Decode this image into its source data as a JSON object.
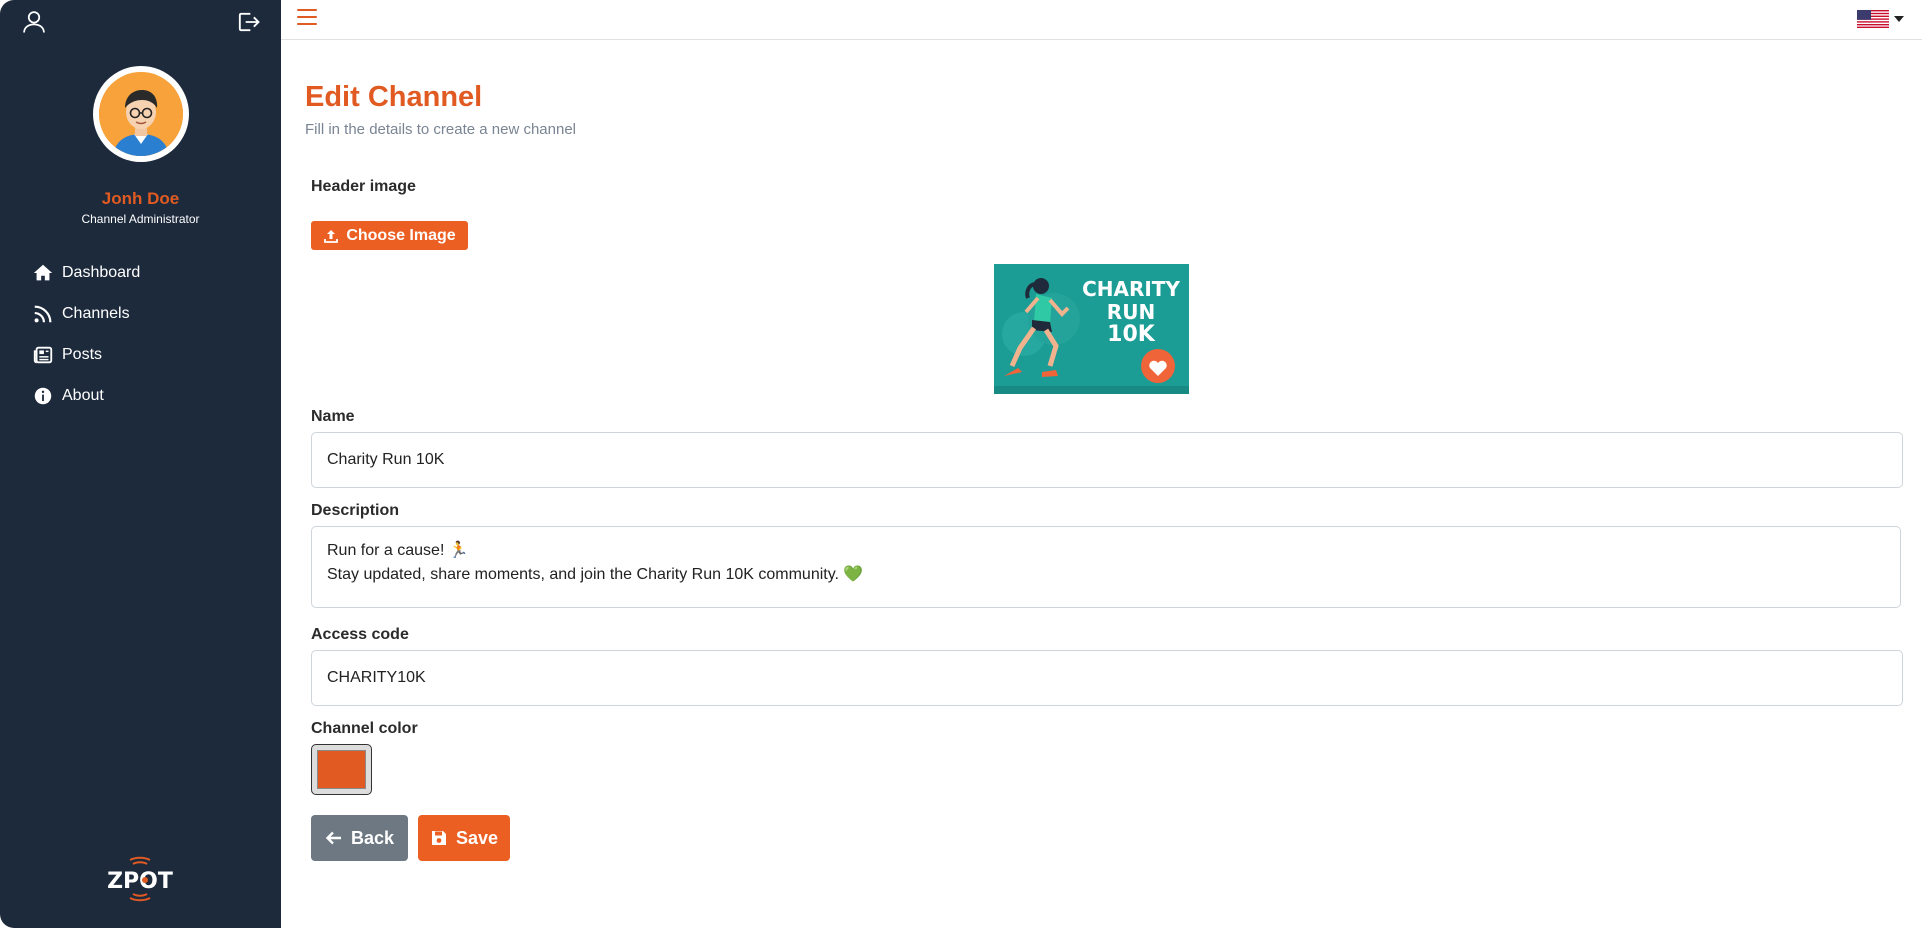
{
  "sidebar": {
    "user": {
      "name": "Jonh Doe",
      "role": "Channel Administrator"
    },
    "items": [
      {
        "label": "Dashboard",
        "icon": "home-icon"
      },
      {
        "label": "Channels",
        "icon": "rss-icon"
      },
      {
        "label": "Posts",
        "icon": "newspaper-icon"
      },
      {
        "label": "About",
        "icon": "info-icon"
      }
    ],
    "logo": "ZPOT"
  },
  "topbar": {
    "language": "en-US"
  },
  "page": {
    "title": "Edit Channel",
    "subtitle": "Fill in the details to create a new channel"
  },
  "form": {
    "header_image_label": "Header image",
    "choose_image_label": "Choose Image",
    "header_image": {
      "line1": "CHARITY",
      "line2": "RUN",
      "line3": "10K"
    },
    "name_label": "Name",
    "name_value": "Charity Run 10K",
    "description_label": "Description",
    "description_line1": "Run for a cause! 🏃",
    "description_line2": "Stay updated, share moments, and join the Charity Run 10K community. 💚",
    "access_code_label": "Access code",
    "access_code_value": "CHARITY10K",
    "channel_color_label": "Channel color",
    "channel_color_value": "#e05a22",
    "back_label": "Back",
    "save_label": "Save"
  },
  "colors": {
    "sidebar_bg": "#1c2a3c",
    "accent": "#e05a22",
    "back_button": "#6d7882"
  }
}
